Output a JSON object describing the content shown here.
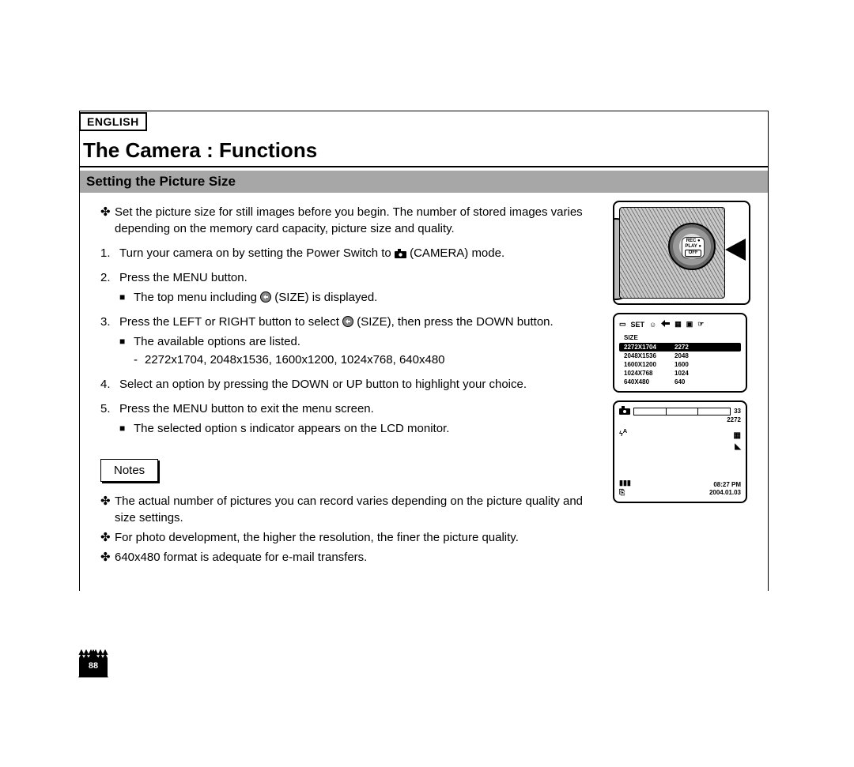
{
  "lang_badge": "ENGLISH",
  "title": "The Camera : Functions",
  "section": "Setting the Picture Size",
  "intro": "Set the picture size for still images before you begin. The number of stored images varies depending on the memory card capacity, picture size and quality.",
  "steps": {
    "s1_pre": "Turn your camera on by setting the Power Switch to ",
    "s1_post": "(CAMERA) mode.",
    "s2": "Press the MENU button.",
    "s2_sub_pre": "The top menu including ",
    "s2_sub_post": "(SIZE) is displayed.",
    "s3_pre": "Press the LEFT or RIGHT button to select ",
    "s3_post": "(SIZE), then press the DOWN button.",
    "s3_sub": "The available options are listed.",
    "s3_opts": "2272x1704, 2048x1536, 1600x1200, 1024x768, 640x480",
    "s4": "Select an option by pressing the DOWN or UP button to highlight your choice.",
    "s5": "Press the MENU button to exit the menu screen.",
    "s5_sub": "The selected option s indicator appears on the LCD monitor."
  },
  "notes_label": "Notes",
  "notes": {
    "n1": "The actual number of pictures you can record varies depending on the picture quality and size settings.",
    "n2": "For photo development, the higher the resolution, the finer the picture quality.",
    "n3": "640x480 format is adequate for e-mail transfers."
  },
  "dial": {
    "l1": "REC ●",
    "l2": "PLAY ●",
    "l3": "OFF"
  },
  "menu": {
    "set_label": "SET",
    "title": "SIZE",
    "rows": [
      {
        "res": "2272X1704",
        "short": "2272",
        "sel": true
      },
      {
        "res": "2048X1536",
        "short": "2048",
        "sel": false
      },
      {
        "res": "1600X1200",
        "short": "1600",
        "sel": false
      },
      {
        "res": "1024X768",
        "short": "1024",
        "sel": false
      },
      {
        "res": "640X480",
        "short": "640",
        "sel": false
      }
    ]
  },
  "status": {
    "shots": "33",
    "size": "2272",
    "flash": "A",
    "time": "08:27 PM",
    "date": "2004.01.03"
  },
  "page_number": "88"
}
